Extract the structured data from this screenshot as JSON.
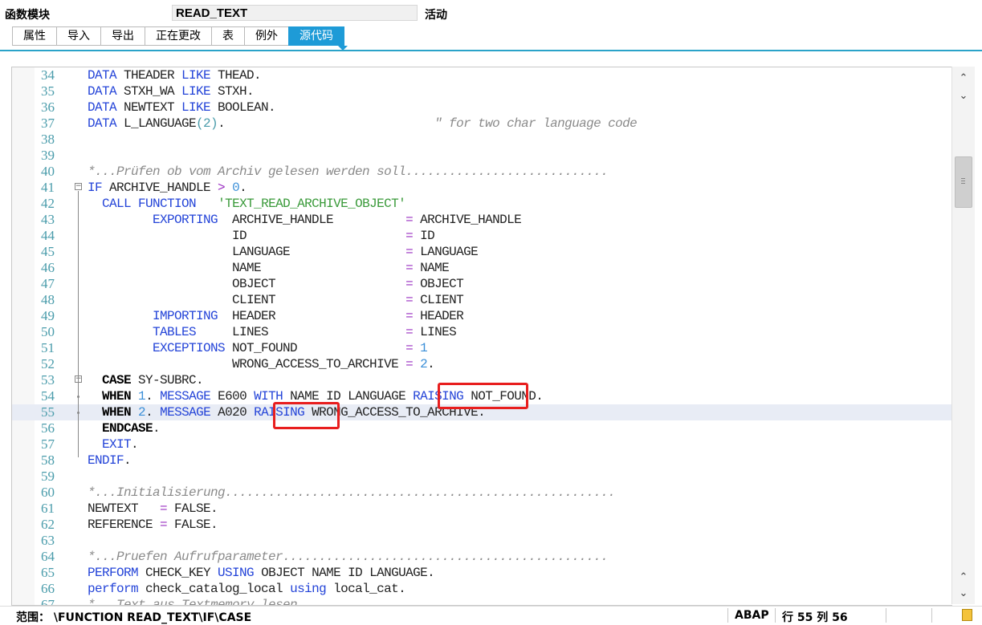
{
  "header": {
    "label": "函数模块",
    "name": "READ_TEXT",
    "status": "活动"
  },
  "tabs": [
    "属性",
    "导入",
    "导出",
    "正在更改",
    "表",
    "例外",
    "源代码"
  ],
  "active_tab": 6,
  "code_lines": [
    {
      "n": "34",
      "t": [
        [
          "k",
          "DATA"
        ],
        [
          "",
          " THEADER "
        ],
        [
          "k",
          "LIKE"
        ],
        [
          "",
          " THEAD."
        ]
      ]
    },
    {
      "n": "35",
      "t": [
        [
          "k",
          "DATA"
        ],
        [
          "",
          " STXH_WA "
        ],
        [
          "k",
          "LIKE"
        ],
        [
          "",
          " STXH."
        ]
      ]
    },
    {
      "n": "36",
      "t": [
        [
          "k",
          "DATA"
        ],
        [
          "",
          " NEWTEXT "
        ],
        [
          "k",
          "LIKE"
        ],
        [
          "",
          " BOOLEAN."
        ]
      ]
    },
    {
      "n": "37",
      "t": [
        [
          "k",
          "DATA"
        ],
        [
          "",
          " L_LANGUAGE"
        ],
        [
          "p",
          "(2)"
        ],
        [
          "",
          "."
        ],
        [
          "c",
          "                             \" for two char language code"
        ]
      ]
    },
    {
      "n": "38",
      "t": []
    },
    {
      "n": "39",
      "t": []
    },
    {
      "n": "40",
      "t": [
        [
          "c",
          "*...Prüfen ob vom Archiv gelesen werden soll............................"
        ]
      ]
    },
    {
      "n": "41",
      "t": [
        [
          "k",
          "IF"
        ],
        [
          "",
          " ARCHIVE_HANDLE "
        ],
        [
          "o",
          ">"
        ],
        [
          "",
          " "
        ],
        [
          "n",
          "0"
        ],
        [
          "",
          "."
        ]
      ]
    },
    {
      "n": "42",
      "t": [
        [
          "",
          "  "
        ],
        [
          "k",
          "CALL FUNCTION"
        ],
        [
          "",
          "   "
        ],
        [
          "s",
          "'TEXT_READ_ARCHIVE_OBJECT'"
        ]
      ]
    },
    {
      "n": "43",
      "t": [
        [
          "",
          "         "
        ],
        [
          "k",
          "EXPORTING"
        ],
        [
          "",
          "  ARCHIVE_HANDLE          "
        ],
        [
          "o",
          "="
        ],
        [
          "",
          " ARCHIVE_HANDLE"
        ]
      ]
    },
    {
      "n": "44",
      "t": [
        [
          "",
          "                    ID                      "
        ],
        [
          "o",
          "="
        ],
        [
          "",
          " ID"
        ]
      ]
    },
    {
      "n": "45",
      "t": [
        [
          "",
          "                    LANGUAGE                "
        ],
        [
          "o",
          "="
        ],
        [
          "",
          " LANGUAGE"
        ]
      ]
    },
    {
      "n": "46",
      "t": [
        [
          "",
          "                    NAME                    "
        ],
        [
          "o",
          "="
        ],
        [
          "",
          " NAME"
        ]
      ]
    },
    {
      "n": "47",
      "t": [
        [
          "",
          "                    OBJECT                  "
        ],
        [
          "o",
          "="
        ],
        [
          "",
          " OBJECT"
        ]
      ]
    },
    {
      "n": "48",
      "t": [
        [
          "",
          "                    CLIENT                  "
        ],
        [
          "o",
          "="
        ],
        [
          "",
          " CLIENT"
        ]
      ]
    },
    {
      "n": "49",
      "t": [
        [
          "",
          "         "
        ],
        [
          "k",
          "IMPORTING"
        ],
        [
          "",
          "  HEADER                  "
        ],
        [
          "o",
          "="
        ],
        [
          "",
          " HEADER"
        ]
      ]
    },
    {
      "n": "50",
      "t": [
        [
          "",
          "         "
        ],
        [
          "k",
          "TABLES"
        ],
        [
          "",
          "     LINES                   "
        ],
        [
          "o",
          "="
        ],
        [
          "",
          " LINES"
        ]
      ]
    },
    {
      "n": "51",
      "t": [
        [
          "",
          "         "
        ],
        [
          "k",
          "EXCEPTIONS"
        ],
        [
          "",
          " NOT_FOUND               "
        ],
        [
          "o",
          "="
        ],
        [
          "",
          " "
        ],
        [
          "n",
          "1"
        ]
      ]
    },
    {
      "n": "52",
      "t": [
        [
          "",
          "                    WRONG_ACCESS_TO_ARCHIVE "
        ],
        [
          "o",
          "="
        ],
        [
          "",
          " "
        ],
        [
          "n",
          "2"
        ],
        [
          "",
          "."
        ]
      ]
    },
    {
      "n": "53",
      "t": [
        [
          "",
          "  "
        ],
        [
          "b",
          "CASE"
        ],
        [
          "",
          " SY-SUBRC."
        ]
      ]
    },
    {
      "n": "54",
      "t": [
        [
          "",
          "  "
        ],
        [
          "b",
          "WHEN"
        ],
        [
          "",
          " "
        ],
        [
          "n",
          "1"
        ],
        [
          "",
          "."
        ],
        [
          "",
          " "
        ],
        [
          "k",
          "MESSAGE"
        ],
        [
          "",
          " E600 "
        ],
        [
          "k",
          "WITH"
        ],
        [
          "",
          " NAME ID LANGUAGE "
        ],
        [
          "k",
          "RAISING"
        ],
        [
          "",
          " NOT_FOUND."
        ]
      ]
    },
    {
      "n": "55",
      "t": [
        [
          "",
          "  "
        ],
        [
          "b",
          "WHEN"
        ],
        [
          "",
          " "
        ],
        [
          "n",
          "2"
        ],
        [
          "",
          "."
        ],
        [
          "",
          " "
        ],
        [
          "k",
          "MESSAGE"
        ],
        [
          "",
          " A020 "
        ],
        [
          "k",
          "RAISING"
        ],
        [
          "",
          " WRONG_ACCESS_TO_ARCHIVE."
        ]
      ]
    },
    {
      "n": "56",
      "t": [
        [
          "",
          "  "
        ],
        [
          "b",
          "ENDCASE"
        ],
        [
          "",
          "."
        ]
      ]
    },
    {
      "n": "57",
      "t": [
        [
          "",
          "  "
        ],
        [
          "k",
          "EXIT"
        ],
        [
          "",
          "."
        ]
      ]
    },
    {
      "n": "58",
      "t": [
        [
          "k",
          "ENDIF"
        ],
        [
          "",
          "."
        ]
      ]
    },
    {
      "n": "59",
      "t": []
    },
    {
      "n": "60",
      "t": [
        [
          "c",
          "*...Initialisierung......................................................"
        ]
      ]
    },
    {
      "n": "61",
      "t": [
        [
          "",
          "NEWTEXT   "
        ],
        [
          "o",
          "="
        ],
        [
          "",
          " FALSE."
        ]
      ]
    },
    {
      "n": "62",
      "t": [
        [
          "",
          "REFERENCE "
        ],
        [
          "o",
          "="
        ],
        [
          "",
          " FALSE."
        ]
      ]
    },
    {
      "n": "63",
      "t": []
    },
    {
      "n": "64",
      "t": [
        [
          "c",
          "*...Pruefen Aufrufparameter............................................."
        ]
      ]
    },
    {
      "n": "65",
      "t": [
        [
          "k",
          "PERFORM"
        ],
        [
          "",
          " CHECK_KEY "
        ],
        [
          "k",
          "USING"
        ],
        [
          "",
          " OBJECT NAME ID LANGUAGE."
        ]
      ]
    },
    {
      "n": "66",
      "t": [
        [
          "k",
          "perform"
        ],
        [
          "",
          " check_catalog_local "
        ],
        [
          "k",
          "using"
        ],
        [
          "",
          " local_cat."
        ]
      ]
    },
    {
      "n": "67",
      "t": [
        [
          "c",
          "*...Text aus Textmemory lesen"
        ]
      ]
    }
  ],
  "current_line": "55",
  "statusbar": {
    "scope": "范围： \\FUNCTION READ_TEXT\\IF\\CASE",
    "language": "ABAP",
    "position": "行 55 列 56"
  },
  "icons": {
    "scroll_up": "chevron-up-icon",
    "scroll_down": "chevron-down-icon"
  }
}
